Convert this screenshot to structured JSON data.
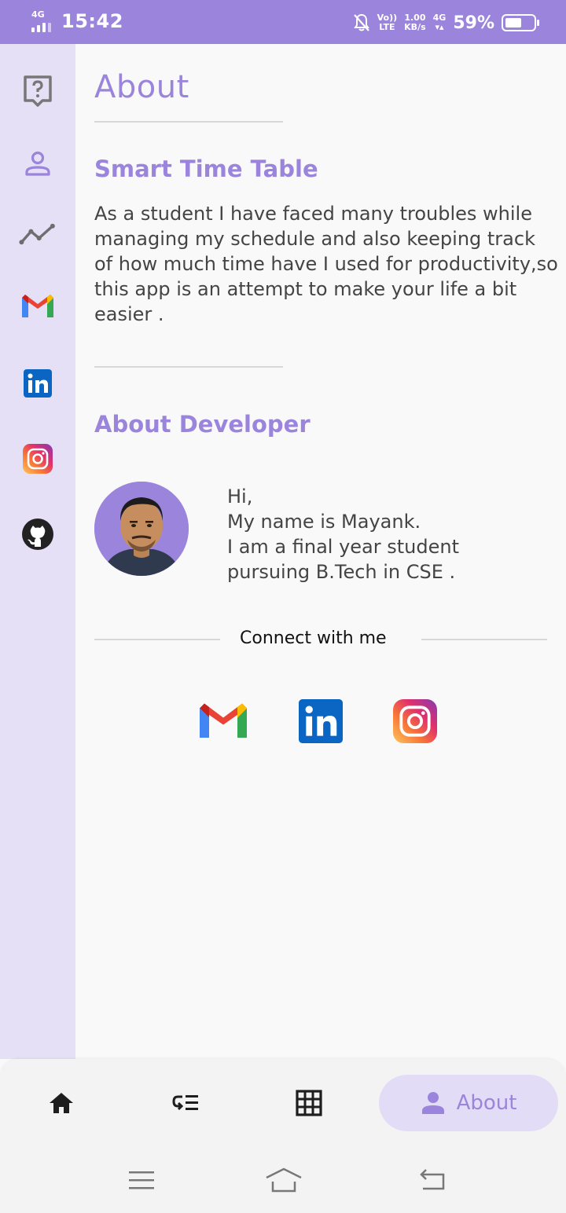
{
  "status_bar": {
    "network_tag": "4G",
    "time": "15:42",
    "volte_top": "Vo))",
    "volte_bottom": "LTE",
    "speed_top": "1.00",
    "speed_bottom": "KB/s",
    "net_type": "4G",
    "battery_percent": "59%",
    "battery_level": 0.59
  },
  "side_rail": {
    "items": [
      {
        "icon": "help-icon"
      },
      {
        "icon": "person-icon"
      },
      {
        "icon": "trend-icon"
      },
      {
        "icon": "gmail-icon"
      },
      {
        "icon": "linkedin-icon"
      },
      {
        "icon": "instagram-icon"
      },
      {
        "icon": "github-icon"
      }
    ]
  },
  "page": {
    "title": "About",
    "app_section_title": "Smart Time Table",
    "app_description": "As a student I have faced many troubles while managing my schedule and also keeping track of how much time have I used for productivity,so this app is an attempt to make your life a bit easier .",
    "developer_section_title": "About Developer",
    "developer_lines": [
      "Hi,",
      "My name is Mayank.",
      "I am a final year student",
      "pursuing B.Tech in CSE ."
    ],
    "connect_label": "Connect with me"
  },
  "bottom_nav": {
    "items": [
      {
        "icon": "home-icon"
      },
      {
        "icon": "list-icon"
      },
      {
        "icon": "grid-icon"
      },
      {
        "icon": "person-icon",
        "label": "About",
        "active": true
      }
    ]
  },
  "colors": {
    "accent": "#9b84dc",
    "rail_bg": "#e6e0f7",
    "active_pill": "#e3dcf6"
  }
}
